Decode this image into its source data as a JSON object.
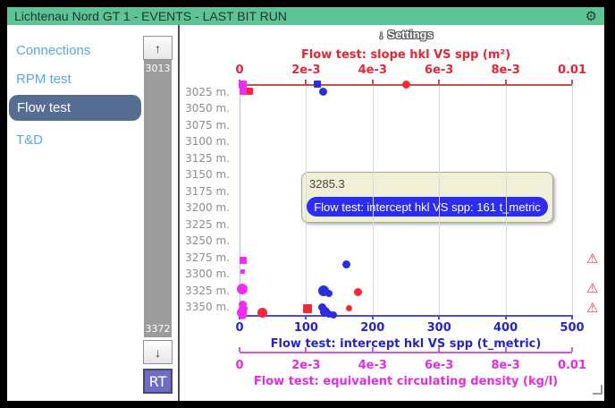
{
  "window": {
    "title": "Lichtenau Nord GT 1 - EVENTS - LAST BIT RUN"
  },
  "colors": {
    "titlebar": "#5dc495",
    "sidebar_link": "#58aadc",
    "active_item_bg": "#566c92",
    "warning": "#f02e3e",
    "tooltip_pill_bg": "#2d2df2"
  },
  "sidebar": {
    "items": [
      {
        "label": "Connections",
        "slug": "connections",
        "active": false
      },
      {
        "label": "RPM test",
        "slug": "rpm-test",
        "active": false
      },
      {
        "label": "Flow test",
        "slug": "flow-test",
        "active": true
      },
      {
        "label": "T&D",
        "slug": "td",
        "active": false
      }
    ]
  },
  "depth_scrollbar": {
    "up_arrow": "↑",
    "down_arrow": "↓",
    "top_value": "3013",
    "bottom_value": "3372",
    "rt_label": "RT"
  },
  "settings": {
    "arrow": "↓",
    "label": "Settings"
  },
  "chart_data": {
    "type": "scatter",
    "depth_axis": {
      "unit": "m",
      "top": 3013,
      "bottom": 3362,
      "labels": [
        "3025 m.",
        "3050 m.",
        "3075 m.",
        "3100 m.",
        "3125 m.",
        "3150 m.",
        "3175 m.",
        "3200 m.",
        "3225 m.",
        "3250 m.",
        "3275 m.",
        "3300 m.",
        "3325 m.",
        "3350 m."
      ],
      "label_values": [
        3025,
        3050,
        3075,
        3100,
        3125,
        3150,
        3175,
        3200,
        3225,
        3250,
        3275,
        3300,
        3325,
        3350
      ]
    },
    "axes": [
      {
        "id": "slope",
        "position": "top",
        "title": "Flow test: slope hkl VS spp (m²)",
        "color": "#e32636",
        "line_color": "#c9504a",
        "min": 0,
        "max": 0.01,
        "ticks": [
          "0",
          "2e-3",
          "4e-3",
          "6e-3",
          "8e-3",
          "0.01"
        ]
      },
      {
        "id": "intercept",
        "position": "bottom",
        "title": "Flow test: intercept hkl VS spp (t_metric)",
        "color": "#2424cc",
        "line_color": "#4f4fc0",
        "min": 0,
        "max": 500,
        "ticks": [
          "0",
          "100",
          "200",
          "300",
          "400",
          "500"
        ]
      },
      {
        "id": "ecd",
        "position": "bottom2",
        "title": "Flow test: equivalent circulating density (kg/l)",
        "color": "#e22ce2",
        "line_color": "#d258c8",
        "min": 0,
        "max": 0.01,
        "ticks": [
          "0",
          "2e-3",
          "4e-3",
          "6e-3",
          "8e-3",
          "0.01"
        ]
      }
    ],
    "series": [
      {
        "name": "Flow test: slope hkl VS spp",
        "unit": "m²",
        "axis": "slope",
        "color": "#f42837",
        "points": [
          {
            "value": 0.0003,
            "depth": 3024,
            "size": 8,
            "shape": "square"
          },
          {
            "value": 0.005,
            "depth": 3014,
            "size": 9,
            "shape": "circle"
          },
          {
            "value": 0.00355,
            "depth": 3327,
            "size": 9,
            "shape": "circle"
          },
          {
            "value": 0.00205,
            "depth": 3352,
            "size": 10,
            "shape": "square"
          },
          {
            "value": 0.0033,
            "depth": 3352,
            "size": 7,
            "shape": "circle"
          },
          {
            "value": 0.00068,
            "depth": 3359,
            "size": 11,
            "shape": "circle"
          }
        ]
      },
      {
        "name": "Flow test: intercept hkl VS spp",
        "unit": "t_metric",
        "axis": "intercept",
        "color": "#2d2de0",
        "points": [
          {
            "value": 117,
            "depth": 3013,
            "size": 8,
            "shape": "square"
          },
          {
            "value": 126,
            "depth": 3024,
            "size": 9,
            "shape": "circle"
          },
          {
            "value": 161,
            "depth": 3285.3,
            "size": 9,
            "shape": "circle"
          },
          {
            "value": 127,
            "depth": 3326,
            "size": 12,
            "shape": "circle"
          },
          {
            "value": 134,
            "depth": 3329,
            "size": 8,
            "shape": "circle"
          },
          {
            "value": 124,
            "depth": 3351,
            "size": 9,
            "shape": "circle"
          },
          {
            "value": 129,
            "depth": 3357,
            "size": 11,
            "shape": "circle"
          },
          {
            "value": 135,
            "depth": 3361,
            "size": 8,
            "shape": "circle"
          },
          {
            "value": 141,
            "depth": 3362,
            "size": 8,
            "shape": "circle"
          }
        ]
      },
      {
        "name": "Flow test: equivalent circulating density",
        "unit": "kg/l",
        "axis": "ecd",
        "color": "#f02cf0",
        "points": [
          {
            "value": 0.0001,
            "depth": 3013,
            "size": 9,
            "shape": "square"
          },
          {
            "value": 0.0001,
            "depth": 3024,
            "size": 8,
            "shape": "square"
          },
          {
            "value": 0.0001,
            "depth": 3280,
            "size": 8,
            "shape": "square"
          },
          {
            "value": 0.0001,
            "depth": 3297,
            "size": 5,
            "shape": "square"
          },
          {
            "value": 8e-05,
            "depth": 3323,
            "size": 12,
            "shape": "circle"
          },
          {
            "value": 0.0001,
            "depth": 3347,
            "size": 9,
            "shape": "circle"
          },
          {
            "value": 0.00012,
            "depth": 3353,
            "size": 10,
            "shape": "circle"
          },
          {
            "value": 6e-05,
            "depth": 3359,
            "size": 11,
            "shape": "circle"
          },
          {
            "value": 0.0001,
            "depth": 3362,
            "size": 9,
            "shape": "circle"
          }
        ]
      }
    ],
    "warnings": [
      {
        "depth": 3278
      },
      {
        "depth": 3323
      },
      {
        "depth": 3352
      }
    ],
    "warning_glyph": "⚠",
    "tooltip": {
      "depth": "3285.3",
      "series": "Flow test: intercept hkl VS spp",
      "value": 161,
      "unit": "t_metric",
      "text": "Flow test: intercept hkl VS spp: 161 t_metric"
    }
  }
}
